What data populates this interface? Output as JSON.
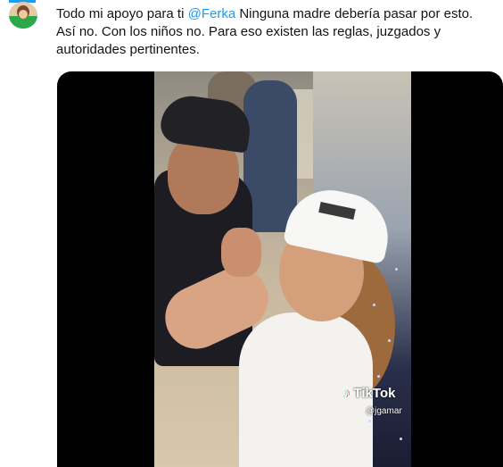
{
  "tweet": {
    "text_before": "Todo mi apoyo para ti ",
    "mention": "@Ferka",
    "text_after": " Ninguna madre debería pasar por esto. Así no. Con los niños no. Para eso existen las reglas, juzgados y autoridades pertinentes."
  },
  "media": {
    "watermark": "TikTok",
    "watermark_icon": "♪",
    "username": "@jgamar"
  }
}
